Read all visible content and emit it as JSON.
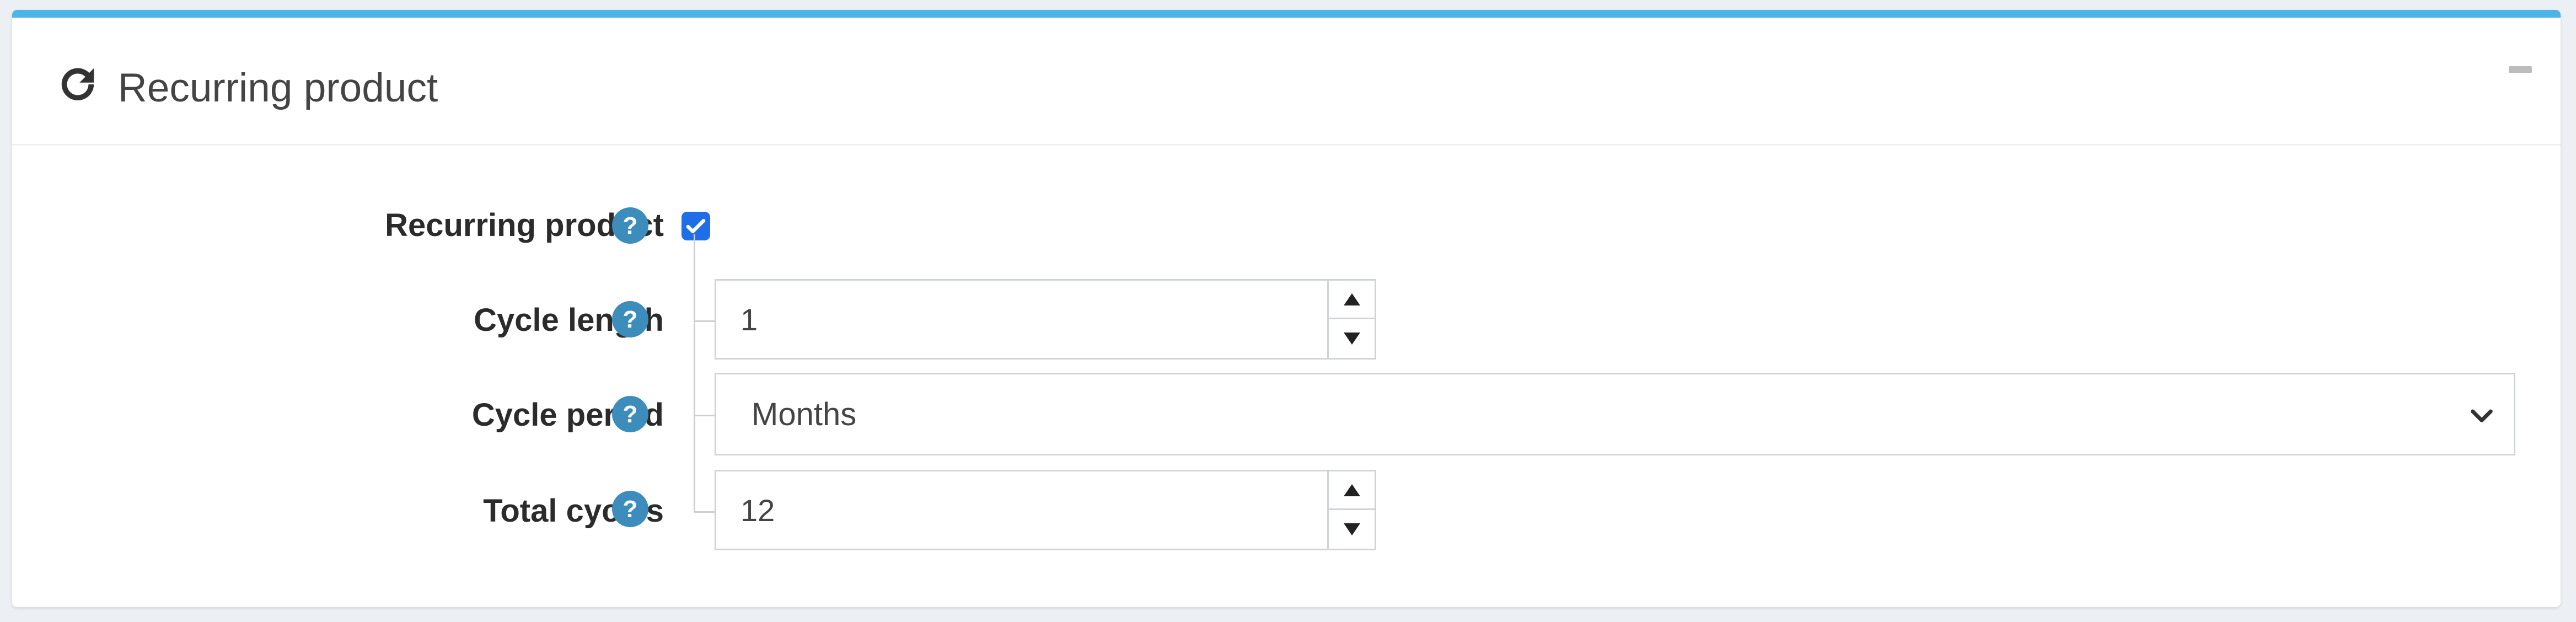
{
  "panel": {
    "title": "Recurring product",
    "header_icon": "refresh-icon",
    "collapse_icon": "minus-icon",
    "accent_color": "#4db5e6"
  },
  "fields": {
    "recurring_product": {
      "label": "Recurring product",
      "checked": true
    },
    "cycle_length": {
      "label": "Cycle length",
      "value": "1"
    },
    "cycle_period": {
      "label": "Cycle period",
      "value": "Months"
    },
    "total_cycles": {
      "label": "Total cycles",
      "value": "12"
    }
  },
  "icons": {
    "help": "question-circle-icon",
    "help_color": "#3c8dbc",
    "checkbox_color": "#1e6ee8"
  }
}
